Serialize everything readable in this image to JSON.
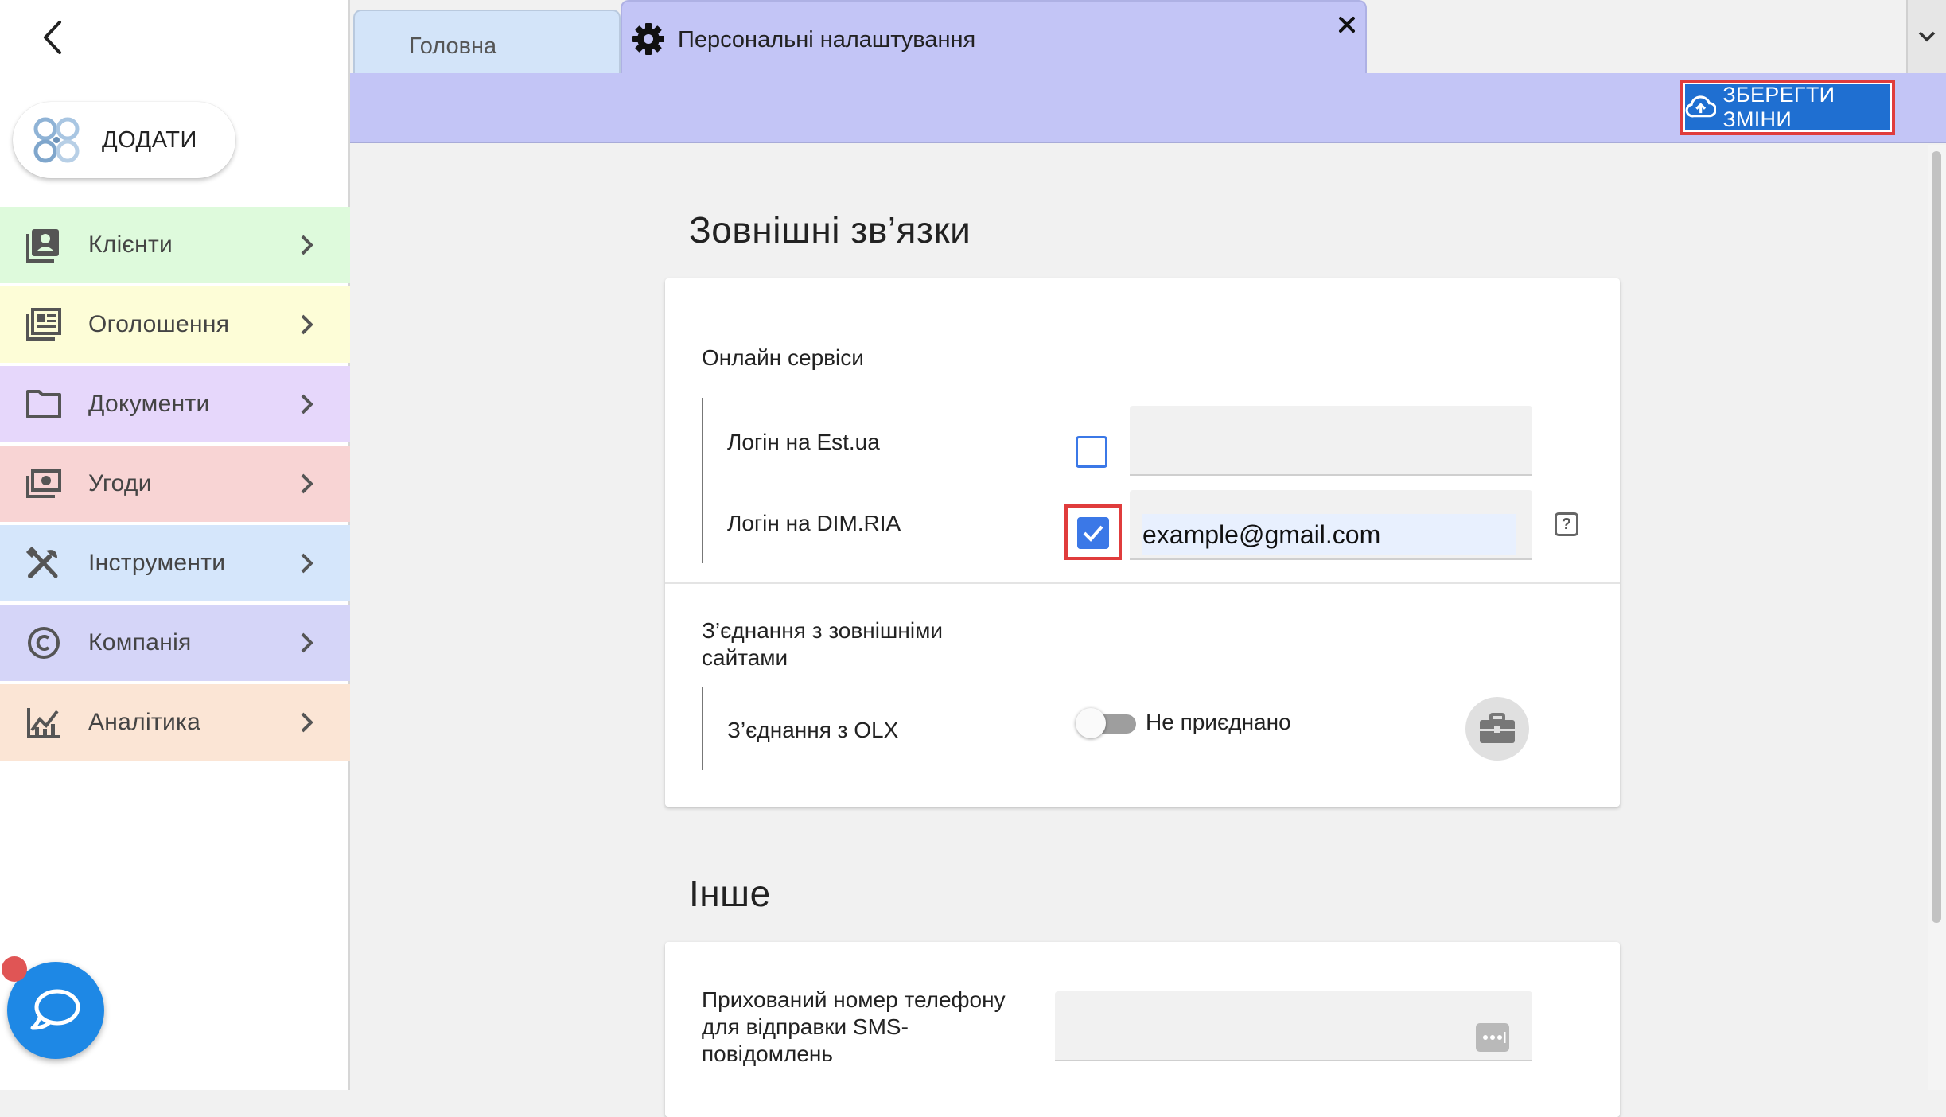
{
  "sidebar": {
    "add_label": "ДОДАТИ",
    "items": [
      {
        "label": "Клієнти",
        "icon": "contacts-icon",
        "color": "#defadc"
      },
      {
        "label": "Оголошення",
        "icon": "listing-icon",
        "color": "#fdfdd7"
      },
      {
        "label": "Документи",
        "icon": "folder-icon",
        "color": "#e6d7fb"
      },
      {
        "label": "Угоди",
        "icon": "money-icon",
        "color": "#f8d4d4"
      },
      {
        "label": "Інструменти",
        "icon": "tools-icon",
        "color": "#d5e6fb"
      },
      {
        "label": "Компанія",
        "icon": "copyright-icon",
        "color": "#d5d5f8"
      },
      {
        "label": "Аналітика",
        "icon": "analytics-icon",
        "color": "#fbe5d5"
      }
    ]
  },
  "tabs": {
    "home": "Головна",
    "active": "Персональні налаштування"
  },
  "toolbar": {
    "save_label": "ЗБЕРЕГТИ ЗМІНИ"
  },
  "external": {
    "title": "Зовнішні зв’язки",
    "online_title": "Онлайн сервіси",
    "est_label": "Логін на Est.ua",
    "est_checked": false,
    "est_value": "",
    "dim_label": "Логін на DIM.RIA",
    "dim_checked": true,
    "dim_value": "example@gmail.com",
    "help": "?",
    "sites_title": "З’єднання з зовнішніми сайтами",
    "olx_label": "З’єднання з OLX",
    "olx_status": "Не приєднано"
  },
  "other": {
    "title": "Інше",
    "hidden_phone_label": "Прихований номер телефону для відправки SMS-повідомлень"
  }
}
